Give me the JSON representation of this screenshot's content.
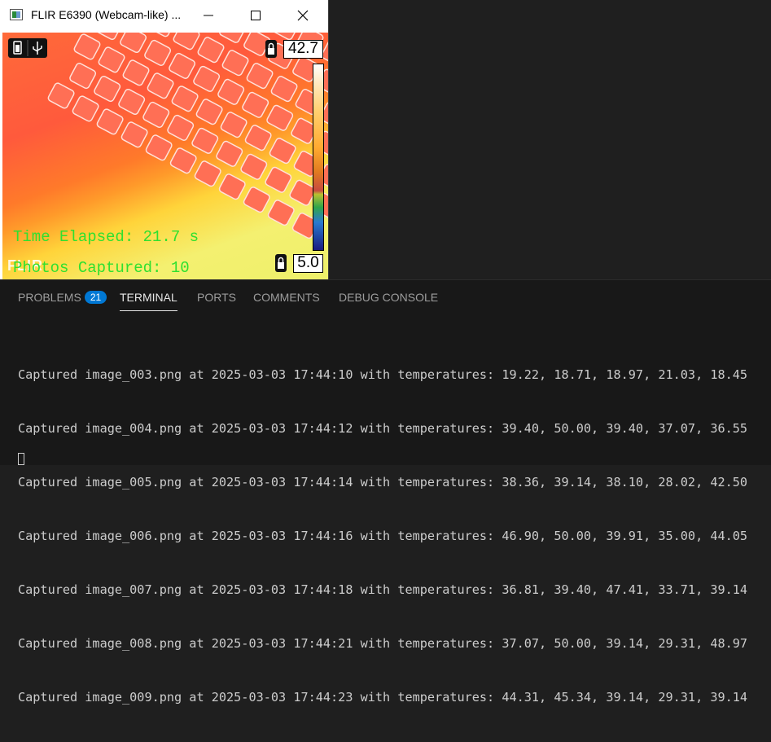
{
  "window": {
    "title": "FLIR E6390 (Webcam-like) ...",
    "controls": [
      "minimize",
      "maximize",
      "close"
    ]
  },
  "camera": {
    "temp_max": "42.7",
    "temp_min": "5.0",
    "time_elapsed": "Time Elapsed: 21.7 s",
    "photos_captured": "Photos Captured: 10",
    "logo": "FLIR",
    "icons": [
      "battery-icon",
      "usb-icon",
      "lock-icon"
    ]
  },
  "panel": {
    "tabs": [
      {
        "label": "PROBLEMS",
        "badge": "21"
      },
      {
        "label": "TERMINAL",
        "active": true
      },
      {
        "label": "PORTS"
      },
      {
        "label": "COMMENTS"
      },
      {
        "label": "DEBUG CONSOLE"
      }
    ],
    "terminal_lines": [
      "Captured image_003.png at 2025-03-03 17:44:10 with temperatures: 19.22, 18.71, 18.97, 21.03, 18.45",
      "Captured image_004.png at 2025-03-03 17:44:12 with temperatures: 39.40, 50.00, 39.40, 37.07, 36.55",
      "Captured image_005.png at 2025-03-03 17:44:14 with temperatures: 38.36, 39.14, 38.10, 28.02, 42.50",
      "Captured image_006.png at 2025-03-03 17:44:16 with temperatures: 46.90, 50.00, 39.91, 35.00, 44.05",
      "Captured image_007.png at 2025-03-03 17:44:18 with temperatures: 36.81, 39.40, 47.41, 33.71, 39.14",
      "Captured image_008.png at 2025-03-03 17:44:21 with temperatures: 37.07, 50.00, 39.14, 29.31, 48.97",
      "Captured image_009.png at 2025-03-03 17:44:23 with temperatures: 44.31, 45.34, 39.14, 29.31, 39.14"
    ]
  }
}
